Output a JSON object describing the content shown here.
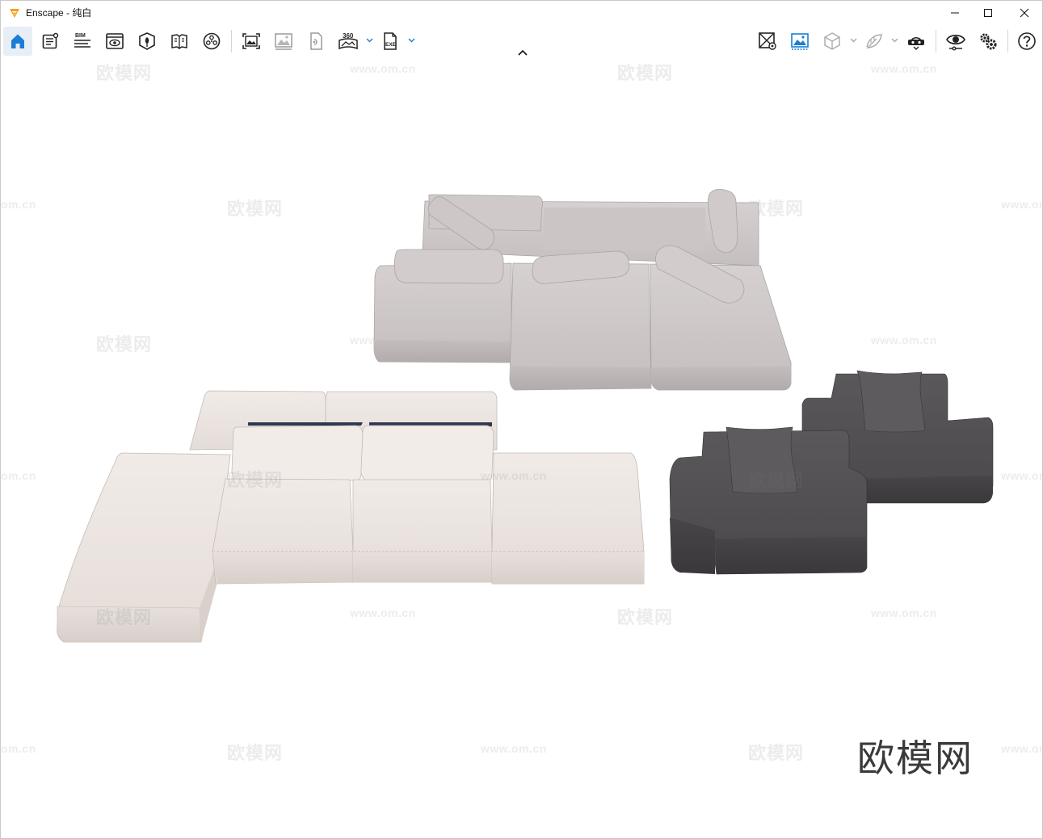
{
  "window": {
    "title": "Enscape - 纯白",
    "controls": [
      "minimize",
      "maximize",
      "close"
    ]
  },
  "toolbar": {
    "left_tools": [
      {
        "name": "home-icon",
        "active": true
      },
      {
        "name": "project-notes-icon"
      },
      {
        "name": "bim-icon",
        "label": "BIM"
      },
      {
        "name": "view-management-icon"
      },
      {
        "name": "site-context-icon"
      },
      {
        "name": "material-editor-icon"
      },
      {
        "name": "asset-library-icon"
      },
      {
        "name": "screenshot-icon"
      },
      {
        "name": "batch-render-icon"
      },
      {
        "name": "video-editor-icon"
      },
      {
        "name": "panorama-icon",
        "label": "360"
      },
      {
        "name": "export-exe-icon",
        "label": "EXE"
      }
    ],
    "right_tools": [
      {
        "name": "sync-views-icon"
      },
      {
        "name": "sync-update-icon",
        "active": true
      },
      {
        "name": "orthographic-cube-icon"
      },
      {
        "name": "light-view-icon"
      },
      {
        "name": "vr-headset-icon"
      },
      {
        "name": "visual-settings-icon"
      },
      {
        "name": "general-settings-icon"
      },
      {
        "name": "help-icon"
      }
    ]
  },
  "watermark": {
    "cn": "欧模网",
    "url": "www.om.cn",
    "brand": "欧模网"
  },
  "colors": {
    "accent": "#1a7fd4",
    "sofa_grey": "#c9c4c3",
    "sofa_cream": "#ede6e2",
    "sofa_dark": "#4d4b4d"
  }
}
